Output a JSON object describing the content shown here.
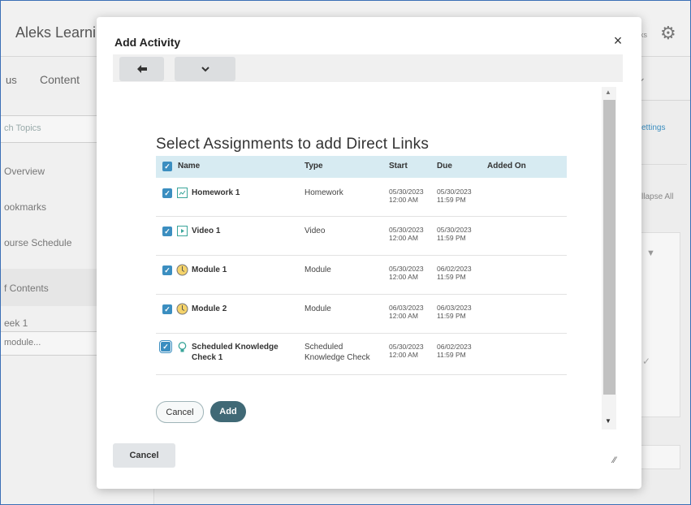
{
  "background": {
    "app_title": "Aleks Learni",
    "top_right_text": "ks",
    "nav_tab_partial": "us",
    "nav_tab_content": "Content",
    "search_placeholder": "ch Topics",
    "links": [
      "Overview",
      "ookmarks",
      "ourse Schedule"
    ],
    "toc_label": "f Contents",
    "week_label": "eek 1",
    "module_placeholder": "module...",
    "settings_link": "ettings",
    "collapse_link": "llapse All"
  },
  "modal": {
    "title": "Add Activity",
    "close_label": "×",
    "toolbar": {
      "back_icon": "arrow-left-icon",
      "menu_icon": "chevron-down-icon"
    },
    "heading": "Select Assignments to add Direct Links",
    "columns": {
      "name": "Name",
      "type": "Type",
      "start": "Start",
      "due": "Due",
      "added_on": "Added On"
    },
    "rows": [
      {
        "checked": true,
        "icon": "homework-icon",
        "name": "Homework 1",
        "type": "Homework",
        "start_date": "05/30/2023",
        "start_time": "12:00 AM",
        "due_date": "05/30/2023",
        "due_time": "11:59 PM"
      },
      {
        "checked": true,
        "icon": "video-icon",
        "name": "Video 1",
        "type": "Video",
        "start_date": "05/30/2023",
        "start_time": "12:00 AM",
        "due_date": "05/30/2023",
        "due_time": "11:59 PM"
      },
      {
        "checked": true,
        "icon": "module-icon",
        "name": "Module 1",
        "type": "Module",
        "start_date": "05/30/2023",
        "start_time": "12:00 AM",
        "due_date": "06/02/2023",
        "due_time": "11:59 PM"
      },
      {
        "checked": true,
        "icon": "module-icon",
        "name": "Module 2",
        "type": "Module",
        "start_date": "06/03/2023",
        "start_time": "12:00 AM",
        "due_date": "06/03/2023",
        "due_time": "11:59 PM"
      },
      {
        "checked": true,
        "icon": "lightbulb-icon",
        "name_line1": "Scheduled Knowledge",
        "name_line2": "Check 1",
        "type_line1": "Scheduled",
        "type_line2": "Knowledge Check",
        "start_date": "05/30/2023",
        "start_time": "12:00 AM",
        "due_date": "06/02/2023",
        "due_time": "11:59 PM"
      }
    ],
    "cancel_label": "Cancel",
    "add_label": "Add",
    "footer_cancel_label": "Cancel"
  },
  "colors": {
    "header_row": "#d7ebf2",
    "checkbox": "#3b8ec0",
    "add_button": "#406976",
    "accent_link": "#3b8ec0"
  }
}
